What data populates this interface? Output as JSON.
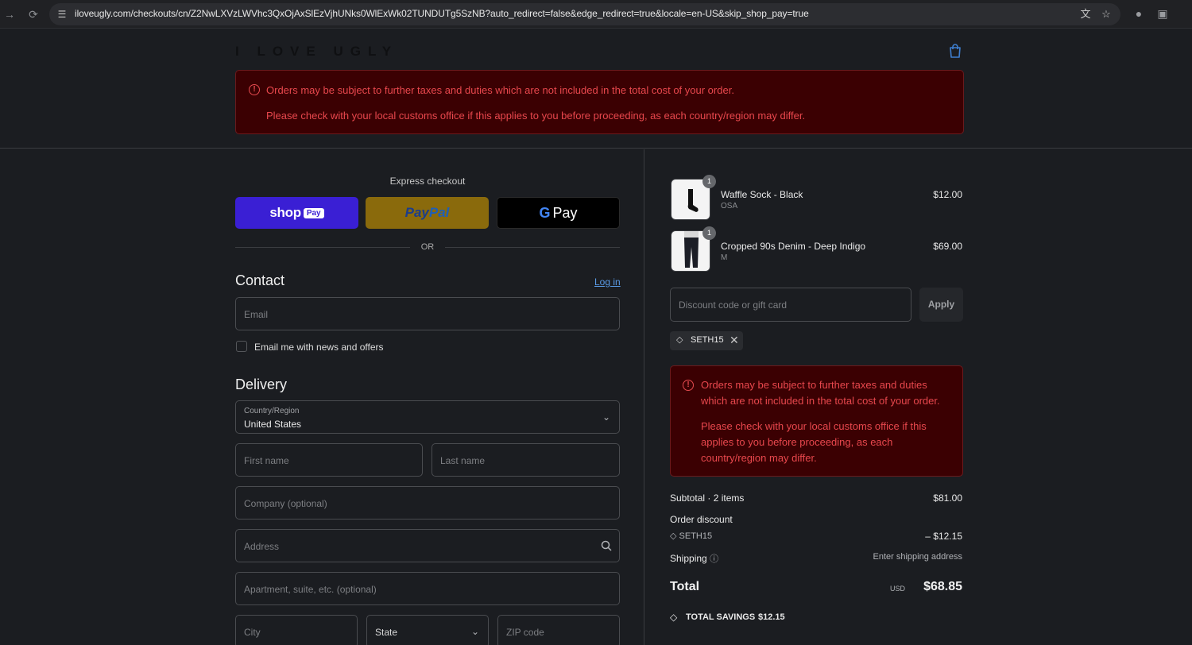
{
  "browser": {
    "url": "iloveugly.com/checkouts/cn/Z2NwLXVzLWVhc3QxOjAxSlEzVjhUNks0WlExWk02TUNDUTg5SzNB?auto_redirect=false&edge_redirect=true&locale=en-US&skip_shop_pay=true"
  },
  "header": {
    "logo": "I LOVE UGLY",
    "banner_line1": "Orders may be subject to further taxes and duties which are not included in the total cost of your order.",
    "banner_line2": "Please check with your local customs office if this applies to you before proceeding, as each country/region may differ."
  },
  "express": {
    "label": "Express checkout",
    "shop_pay": "shop",
    "shop_pay_badge": "Pay",
    "paypal_a": "Pay",
    "paypal_b": "Pal",
    "gpay_g": "G",
    "gpay_word": "Pay",
    "or": "OR"
  },
  "contact": {
    "title": "Contact",
    "login": "Log in",
    "email_placeholder": "Email",
    "newsletter_label": "Email me with news and offers"
  },
  "delivery": {
    "title": "Delivery",
    "country_label": "Country/Region",
    "country_value": "United States",
    "first_name": "First name",
    "last_name": "Last name",
    "company": "Company (optional)",
    "address": "Address",
    "apartment": "Apartment, suite, etc. (optional)",
    "city": "City",
    "state": "State",
    "zip": "ZIP code"
  },
  "cart": {
    "items": [
      {
        "qty": "1",
        "name": "Waffle Sock - Black",
        "variant": "OSA",
        "price": "$12.00"
      },
      {
        "qty": "1",
        "name": "Cropped 90s Denim - Deep Indigo",
        "variant": "M",
        "price": "$69.00"
      }
    ],
    "discount_placeholder": "Discount code or gift card",
    "apply": "Apply",
    "applied_code": "SETH15",
    "banner_line1": "Orders may be subject to further taxes and duties which are not included in the total cost of your order.",
    "banner_line2": "Please check with your local customs office if this applies to you before proceeding, as each country/region may differ."
  },
  "summary": {
    "subtotal_label": "Subtotal · 2 items",
    "subtotal_value": "$81.00",
    "discount_label": "Order discount",
    "discount_code": "SETH15",
    "discount_value": "– $12.15",
    "shipping_label": "Shipping",
    "shipping_value": "Enter shipping address",
    "total_label": "Total",
    "total_currency": "USD",
    "total_value": "$68.85",
    "savings_label": "TOTAL SAVINGS",
    "savings_value": "$12.15"
  },
  "colors": {
    "background": "#1b1d21",
    "error_bg": "#3b0002",
    "error_text": "#e8474d",
    "shop_pay": "#3a1fd4",
    "paypal": "#8a6a0c",
    "link": "#5a9be6"
  }
}
